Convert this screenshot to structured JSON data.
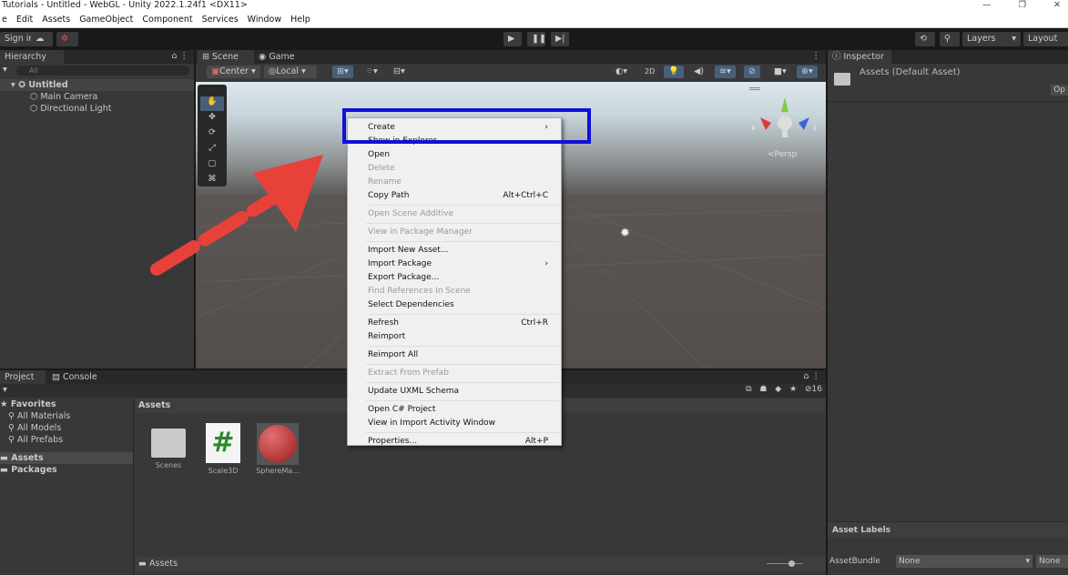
{
  "window": {
    "title": "Tutorials - Untitled - WebGL - Unity 2022.1.24f1 <DX11>",
    "minimize": "—",
    "maximize": "❐",
    "close": "✕"
  },
  "menubar": [
    "e",
    "Edit",
    "Assets",
    "GameObject",
    "Component",
    "Services",
    "Window",
    "Help"
  ],
  "toolbar": {
    "sign_in": "Sign in",
    "layers": "Layers",
    "layout": "Layout"
  },
  "hierarchy": {
    "tab": "Hierarchy",
    "search_placeholder": "All",
    "scene": "Untitled",
    "items": [
      "Main Camera",
      "Directional Light"
    ]
  },
  "scene": {
    "tabs": [
      "Scene",
      "Game"
    ],
    "pivot": "Center",
    "space": "Local",
    "mode_2d": "2D",
    "persp": "<Persp",
    "axis_x": "x",
    "axis_z": "z"
  },
  "inspector": {
    "tab": "Inspector",
    "asset_title": "Assets (Default Asset)",
    "open_button": "Op",
    "asset_labels": "Asset Labels",
    "asset_bundle_label": "AssetBundle",
    "asset_bundle_value": "None",
    "variant_value": "None"
  },
  "project": {
    "tabs": [
      "Project",
      "Console"
    ],
    "favorites": "Favorites",
    "favorite_items": [
      "All Materials",
      "All Models",
      "All Prefabs"
    ],
    "roots": [
      "Assets",
      "Packages"
    ],
    "header": "Assets",
    "assets": [
      "Scenes",
      "Scale3D",
      "SphereMa..."
    ],
    "footer": "Assets",
    "hidden_count": "16"
  },
  "context_menu": [
    {
      "label": "Create",
      "submenu": true
    },
    {
      "label": "Show in Explorer"
    },
    {
      "label": "Open"
    },
    {
      "label": "Delete",
      "disabled": true
    },
    {
      "label": "Rename",
      "disabled": true
    },
    {
      "label": "Copy Path",
      "shortcut": "Alt+Ctrl+C"
    },
    {
      "sep": true
    },
    {
      "label": "Open Scene Additive",
      "disabled": true
    },
    {
      "sep": true
    },
    {
      "label": "View in Package Manager",
      "disabled": true
    },
    {
      "sep": true
    },
    {
      "label": "Import New Asset..."
    },
    {
      "label": "Import Package",
      "submenu": true
    },
    {
      "label": "Export Package..."
    },
    {
      "label": "Find References In Scene",
      "disabled": true
    },
    {
      "label": "Select Dependencies"
    },
    {
      "sep": true
    },
    {
      "label": "Refresh",
      "shortcut": "Ctrl+R"
    },
    {
      "label": "Reimport"
    },
    {
      "sep": true
    },
    {
      "label": "Reimport All"
    },
    {
      "sep": true
    },
    {
      "label": "Extract From Prefab",
      "disabled": true
    },
    {
      "sep": true
    },
    {
      "label": "Update UXML Schema"
    },
    {
      "sep": true
    },
    {
      "label": "Open C# Project"
    },
    {
      "label": "View in Import Activity Window"
    },
    {
      "sep": true
    },
    {
      "label": "Properties...",
      "shortcut": "Alt+P"
    }
  ],
  "colors": {
    "highlight_box": "#1010d8",
    "arrow": "#e8413a",
    "sphere": "#c84848",
    "script_hash": "#2a8a2a"
  }
}
